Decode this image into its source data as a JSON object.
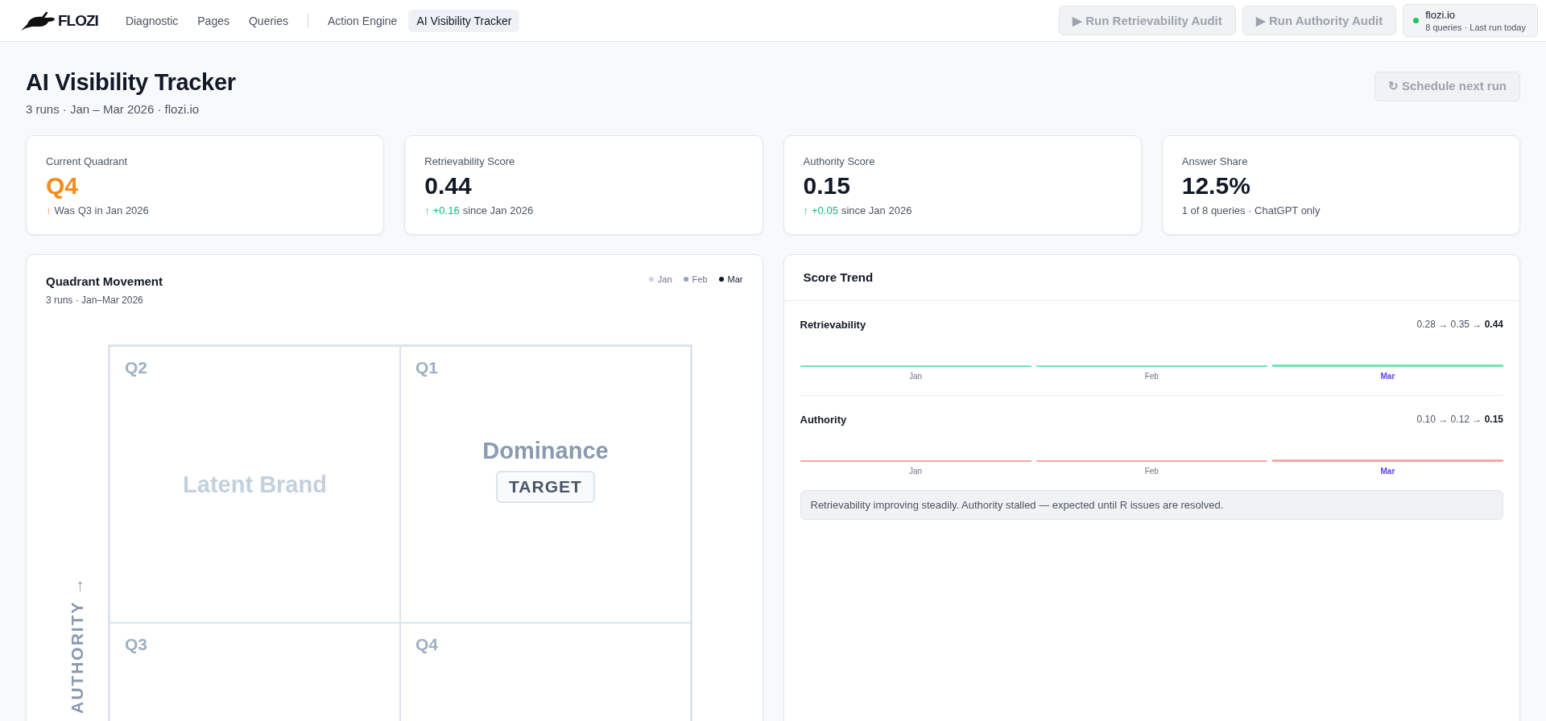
{
  "header": {
    "brand": "FLOZI",
    "nav_groups": [
      [
        {
          "label": "Diagnostic",
          "selected": false
        },
        {
          "label": "Pages",
          "selected": false
        },
        {
          "label": "Queries",
          "selected": false
        }
      ],
      [
        {
          "label": "Action Engine",
          "selected": false
        },
        {
          "label": "AI Visibility Tracker",
          "selected": true
        }
      ]
    ],
    "actions": [
      {
        "label": "▶ Run Retrievability Audit",
        "disabled": true
      },
      {
        "label": "▶ Run Authority Audit",
        "disabled": true
      }
    ],
    "site": {
      "name": "flozi.io",
      "meta": "8 queries · Last run today",
      "color": "#22c55e"
    }
  },
  "page": {
    "title": "AI Visibility Tracker",
    "subtitle": "3 runs · Jan – Mar 2026 · flozi.io",
    "action": {
      "label": "↻ Schedule next run",
      "disabled": true
    }
  },
  "stats": [
    {
      "label": "Current Quadrant",
      "value": "Q4",
      "alert": true,
      "delta_arrow": "↑",
      "delta_text": "Was Q3 in Jan 2026"
    },
    {
      "label": "Retrievability Score",
      "value": "0.44",
      "alert": false,
      "improved": true,
      "delta_arrow": "↑",
      "delta_value": "+0.16",
      "delta_text": "since Jan 2026"
    },
    {
      "label": "Authority Score",
      "value": "0.15",
      "alert": false,
      "improved": true,
      "delta_arrow": "↑",
      "delta_value": "+0.05",
      "delta_text": "since Jan 2026"
    },
    {
      "label": "Answer Share",
      "value": "12.5%",
      "alert": false,
      "delta_text": "1 of 8 queries · ChatGPT only"
    }
  ],
  "quadrant": {
    "title": "Quadrant Movement",
    "subtitle": "3 runs · Jan–Mar 2026",
    "legend": [
      {
        "label": "Jan",
        "color": "#cbd5e1",
        "selected": false
      },
      {
        "label": "Feb",
        "color": "#94a3b8",
        "selected": false
      },
      {
        "label": "Mar",
        "color": "#0f172a",
        "selected": true
      }
    ],
    "axis_label": "AUTHORITY →",
    "cells": [
      {
        "label": "Q2",
        "title": "Latent Brand"
      },
      {
        "label": "Q1",
        "title": "Dominance",
        "badge": "TARGET"
      },
      {
        "label": "Q3"
      },
      {
        "label": "Q4"
      }
    ]
  },
  "trend": {
    "title": "Score Trend",
    "metrics": [
      {
        "name": "Retrievability",
        "values": "0.28 → 0.35 → **0.44**",
        "color": "#6ee7b7",
        "months": [
          {
            "label": "Jan",
            "selected": false
          },
          {
            "label": "Feb",
            "selected": false
          },
          {
            "label": "Mar",
            "selected": true
          }
        ]
      },
      {
        "name": "Authority",
        "values": "0.10 → 0.12 → **0.15**",
        "color": "#fca5a5",
        "months": [
          {
            "label": "Jan",
            "selected": false
          },
          {
            "label": "Feb",
            "selected": false
          },
          {
            "label": "Mar",
            "selected": true
          }
        ]
      }
    ],
    "note": "Retrievability improving steadily. Authority stalled — expected until R issues are resolved."
  }
}
